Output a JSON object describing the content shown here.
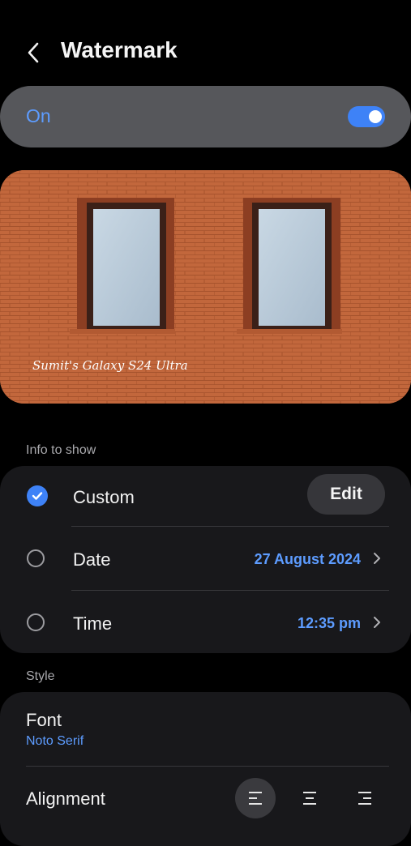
{
  "header": {
    "title": "Watermark",
    "back_icon": "chevron-left-icon"
  },
  "toggle": {
    "label": "On",
    "state": true,
    "accent": "#3e82f7"
  },
  "preview": {
    "watermark_text": "Sumit's Galaxy S24 Ultra"
  },
  "info_section": {
    "heading": "Info to show",
    "items": [
      {
        "label": "Custom",
        "selected": true,
        "action_label": "Edit"
      },
      {
        "label": "Date",
        "selected": false,
        "value": "27 August 2024"
      },
      {
        "label": "Time",
        "selected": false,
        "value": "12:35 pm"
      }
    ]
  },
  "style_section": {
    "heading": "Style",
    "font": {
      "label": "Font",
      "value": "Noto Serif"
    },
    "alignment": {
      "label": "Alignment",
      "options": [
        "left",
        "center",
        "right"
      ],
      "selected": "left"
    }
  },
  "colors": {
    "accent_text": "#5d9cff",
    "brick": "#c0653a",
    "card": "#18181b"
  }
}
